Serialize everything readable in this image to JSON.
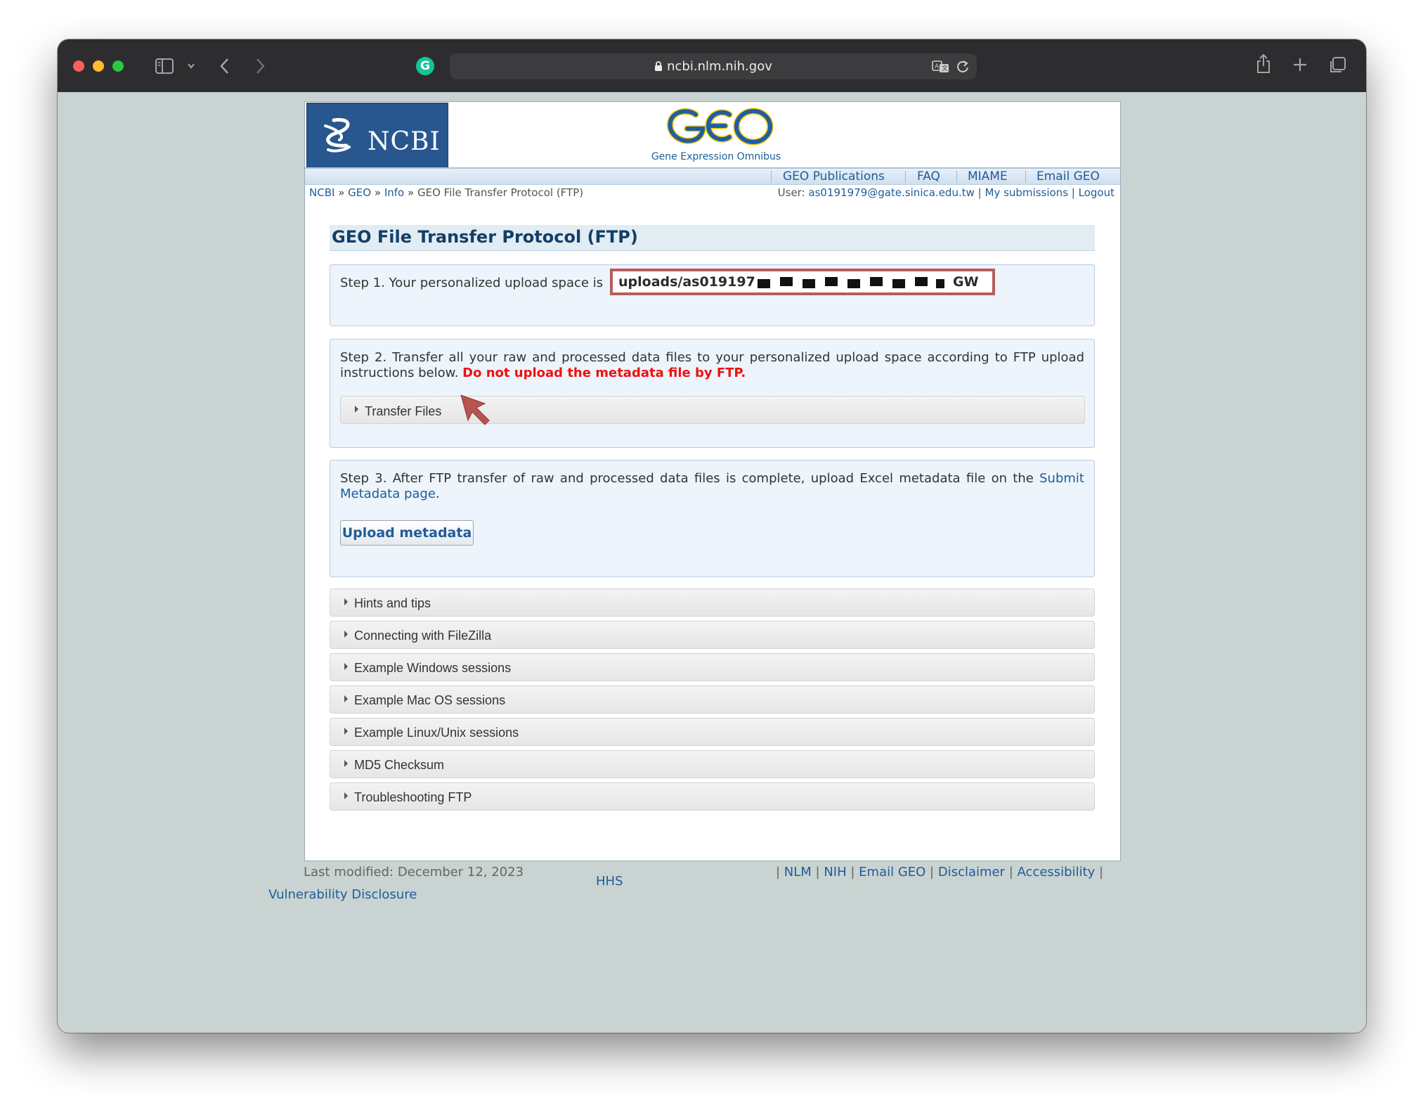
{
  "browser": {
    "url": "ncbi.nlm.nih.gov"
  },
  "header": {
    "ncbi_logo": "NCBI",
    "geo_logo": "GEO",
    "geo_subtitle": "Gene Expression Omnibus",
    "nav": [
      "GEO Publications",
      "FAQ",
      "MIAME",
      "Email GEO"
    ]
  },
  "breadcrumb": {
    "items": [
      "NCBI",
      "GEO",
      "Info"
    ],
    "current": "GEO File Transfer Protocol (FTP)",
    "separator": "»"
  },
  "user_bar": {
    "user_label": "User:",
    "user_email": "as0191979@gate.sinica.edu.tw",
    "my_submissions": "My submissions",
    "logout": "Logout",
    "separator": "|"
  },
  "page_title": "GEO File Transfer Protocol (FTP)",
  "step1": {
    "text": "Step 1. Your personalized upload space is",
    "path_start": "uploads/as019197",
    "path_end": "GW"
  },
  "step2": {
    "text": "Step 2. Transfer all your raw and processed data files to your personalized upload space according to FTP upload instructions below.",
    "warning": "Do not upload the metadata file by FTP.",
    "accordion": "Transfer Files"
  },
  "step3": {
    "text": "Step 3. After FTP transfer of raw and processed data files is complete, upload Excel metadata file on the",
    "link": "Submit Metadata page",
    "period": ".",
    "button": "Upload metadata"
  },
  "sections": [
    "Hints and tips",
    "Connecting with FileZilla",
    "Example Windows sessions",
    "Example Mac OS sessions",
    "Example Linux/Unix sessions",
    "MD5 Checksum",
    "Troubleshooting FTP"
  ],
  "footer": {
    "last_modified": "Last modified: December 12, 2023",
    "hhs": "HHS",
    "links": [
      "NLM",
      "NIH",
      "Email GEO",
      "Disclaimer",
      "Accessibility"
    ],
    "vulnerability": "Vulnerability Disclosure"
  },
  "colors": {
    "link": "#1f5c99",
    "title": "#133f69",
    "warning": "#ee1111",
    "highlight_border": "#b55d5c"
  }
}
